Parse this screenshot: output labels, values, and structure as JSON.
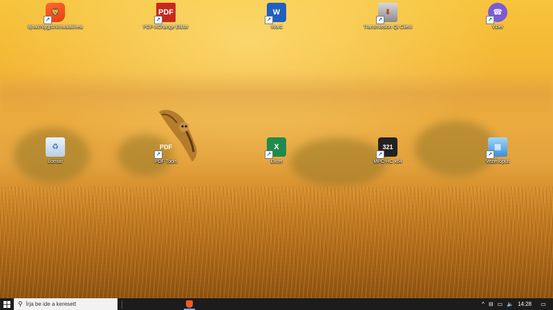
{
  "desktop_icons": [
    {
      "label": "ifjnalchlygjsfnimwalaliivea",
      "icon": "brave-browser-icon",
      "glyph": "🦁",
      "shortcut": true
    },
    {
      "label": "PDF-XChange Editor",
      "icon": "pdf-xchange-editor-icon",
      "glyph": "PDF",
      "shortcut": true
    },
    {
      "label": "Word",
      "icon": "word-icon",
      "glyph": "W",
      "shortcut": true
    },
    {
      "label": "Transmission Qt Client",
      "icon": "transmission-icon",
      "glyph": "⬇",
      "shortcut": true
    },
    {
      "label": "Viber",
      "icon": "viber-icon",
      "glyph": "☎",
      "shortcut": true
    },
    {
      "label": "Lomtár",
      "icon": "recycle-bin-icon",
      "glyph": "♻",
      "shortcut": false
    },
    {
      "label": "PDF Tools",
      "icon": "pdf-tools-icon",
      "glyph": "PDF",
      "shortcut": true
    },
    {
      "label": "Excel",
      "icon": "excel-icon",
      "glyph": "X",
      "shortcut": true
    },
    {
      "label": "MPC-HC x64",
      "icon": "mpc-hc-icon",
      "glyph": "321",
      "shortcut": true
    },
    {
      "label": "Vezérlőpult",
      "icon": "control-panel-icon",
      "glyph": "▦",
      "shortcut": true
    }
  ],
  "taskbar": {
    "start_icon": "windows-start-icon",
    "search_placeholder": "Írja be ide a keresett",
    "pinned_apps": [
      "brave-browser-icon"
    ],
    "tray": {
      "chevron": "^",
      "network": "⊟",
      "display": "▭",
      "volume": "🔈",
      "time": "14:28",
      "notification": "▭"
    }
  },
  "colors": {
    "taskbar": "#1c1c1c",
    "sky": "#f4b935",
    "field": "#b06a18"
  }
}
